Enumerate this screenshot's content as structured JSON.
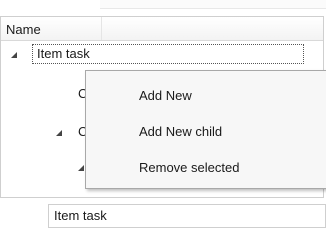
{
  "grid": {
    "column_header": "Name",
    "rows": [
      {
        "label": "Item task",
        "expanded": true
      },
      {
        "label": "C"
      },
      {
        "label": "C",
        "expanded": true
      }
    ]
  },
  "context_menu": {
    "items": [
      "Add New",
      "Add New child",
      "Remove selected"
    ]
  },
  "editor": {
    "value": "Item task"
  },
  "icons": {
    "expand": "expanded-triangle-icon"
  }
}
